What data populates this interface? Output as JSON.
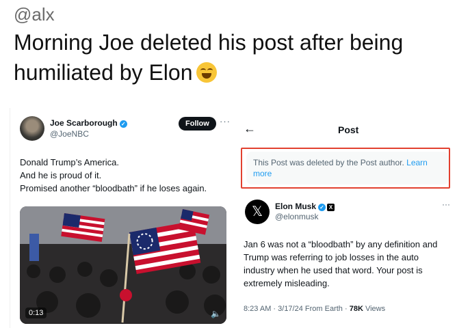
{
  "header": {
    "handle": "@alx",
    "headline": "Morning Joe deleted his post after being humiliated by Elon",
    "emoji": "rolling-on-floor-laughing-emoji"
  },
  "left_tweet": {
    "author_name": "Joe Scarborough",
    "author_handle": "@JoeNBC",
    "follow_label": "Follow",
    "more_label": "···",
    "text_lines": [
      "Donald Trump’s America.",
      "And he is proud of it.",
      "Promised another “bloodbath” if he loses again."
    ],
    "video_timecode": "0:13"
  },
  "right_post": {
    "title": "Post",
    "deleted_notice": "This Post was deleted by the Post author.",
    "learn_more": "Learn more",
    "author_name": "Elon Musk",
    "author_handle": "@elonmusk",
    "more_label": "···",
    "text": "Jan 6 was not a “bloodbath” by any definition and Trump was referring to job losses in the auto industry when he used that word. Your post is extremely misleading.",
    "time": "8:23 AM",
    "date": "3/17/24",
    "source": "From Earth",
    "views_count": "78K",
    "views_label": "Views"
  },
  "colors": {
    "highlight_border": "#e2402f",
    "link_blue": "#1d9bf0",
    "verified_blue": "#1d9bf0"
  }
}
